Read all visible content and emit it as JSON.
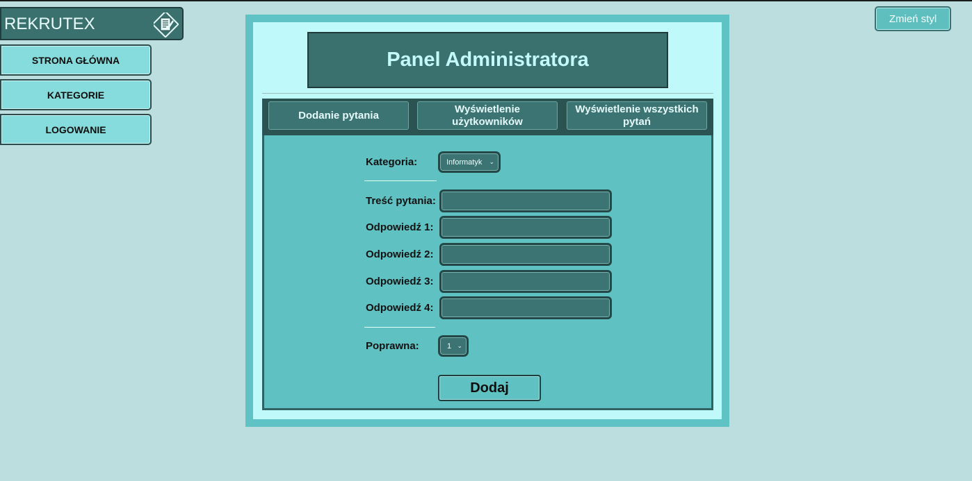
{
  "sidebar": {
    "brand": "REKRUTEX",
    "brand_icon": "notepad-pen-icon",
    "items": [
      {
        "label": "STRONA GŁÓWNA"
      },
      {
        "label": "KATEGORIE"
      },
      {
        "label": "LOGOWANIE"
      }
    ]
  },
  "style_button": {
    "label": "Zmień styl"
  },
  "panel": {
    "title": "Panel Administratora",
    "tabs": [
      {
        "label": "Dodanie pytania"
      },
      {
        "label": "Wyświetlenie użytkowników"
      },
      {
        "label": "Wyświetlenie wszystkich pytań"
      }
    ]
  },
  "form": {
    "category_label": "Kategoria:",
    "category_value": "Informatyk",
    "question_label": "Treść pytania:",
    "answer_labels": [
      "Odpowiedź 1:",
      "Odpowiedź 2:",
      "Odpowiedź 3:",
      "Odpowiedź 4:"
    ],
    "correct_label": "Poprawna:",
    "correct_value": "1",
    "submit_label": "Dodaj"
  },
  "colors": {
    "background": "#bcdedf",
    "panel_border": "#5fc2c4",
    "panel_inner": "#bff9f9",
    "dark_teal": "#3a716f",
    "form_bg": "#5fc1c1"
  }
}
